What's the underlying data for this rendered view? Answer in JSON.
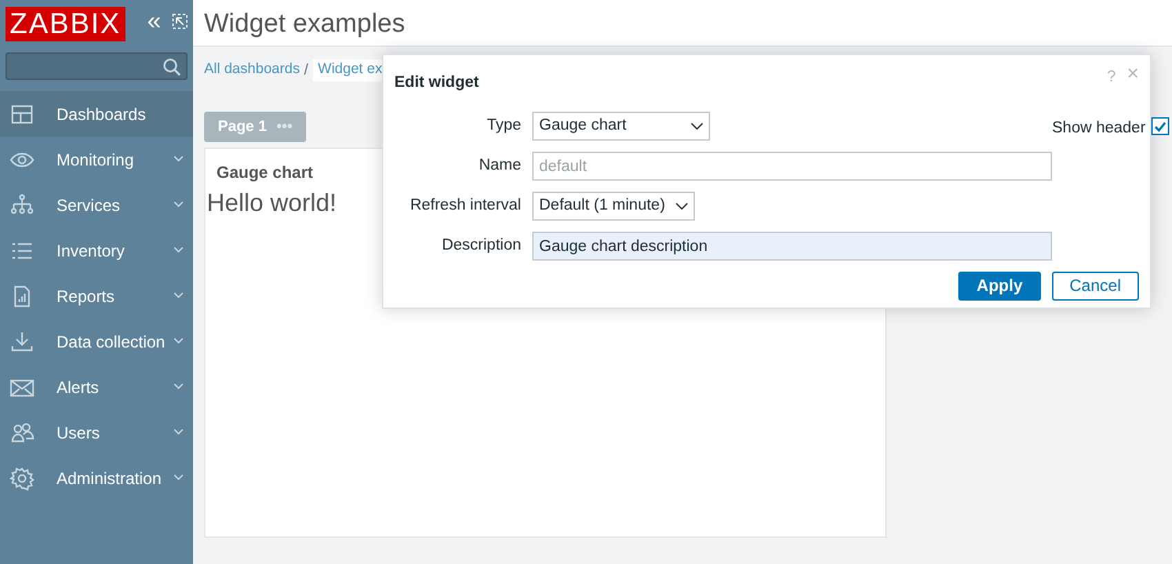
{
  "sidebar": {
    "logo": "ZABBIX",
    "collapse": "«",
    "items": [
      {
        "label": "Dashboards",
        "selected": true,
        "has_submenu": false
      },
      {
        "label": "Monitoring",
        "selected": false,
        "has_submenu": true
      },
      {
        "label": "Services",
        "selected": false,
        "has_submenu": true
      },
      {
        "label": "Inventory",
        "selected": false,
        "has_submenu": true
      },
      {
        "label": "Reports",
        "selected": false,
        "has_submenu": true
      },
      {
        "label": "Data collection",
        "selected": false,
        "has_submenu": true
      },
      {
        "label": "Alerts",
        "selected": false,
        "has_submenu": true
      },
      {
        "label": "Users",
        "selected": false,
        "has_submenu": true
      },
      {
        "label": "Administration",
        "selected": false,
        "has_submenu": true
      }
    ]
  },
  "page": {
    "title": "Widget examples",
    "breadcrumbs": [
      "All dashboards",
      "Widget ex"
    ],
    "breadcrumb_separator": "/",
    "page_tab": {
      "label": "Page 1",
      "menu": "•••"
    },
    "widget": {
      "title": "Gauge chart",
      "body": "Hello world!"
    }
  },
  "dialog": {
    "title": "Edit widget",
    "help": "?",
    "close": "×",
    "fields": [
      {
        "kind": "select",
        "label": "Type",
        "value": "Gauge chart"
      },
      {
        "kind": "text",
        "label": "Name",
        "placeholder": "default"
      },
      {
        "kind": "select",
        "label": "Refresh interval",
        "value": "Default (1 minute)"
      },
      {
        "kind": "text",
        "label": "Description",
        "value": "Gauge chart description"
      }
    ],
    "show_header": {
      "label": "Show header",
      "checked": true
    },
    "buttons": [
      {
        "label": "Apply",
        "kind": "primary"
      },
      {
        "label": "Cancel",
        "kind": "secondary"
      }
    ]
  }
}
